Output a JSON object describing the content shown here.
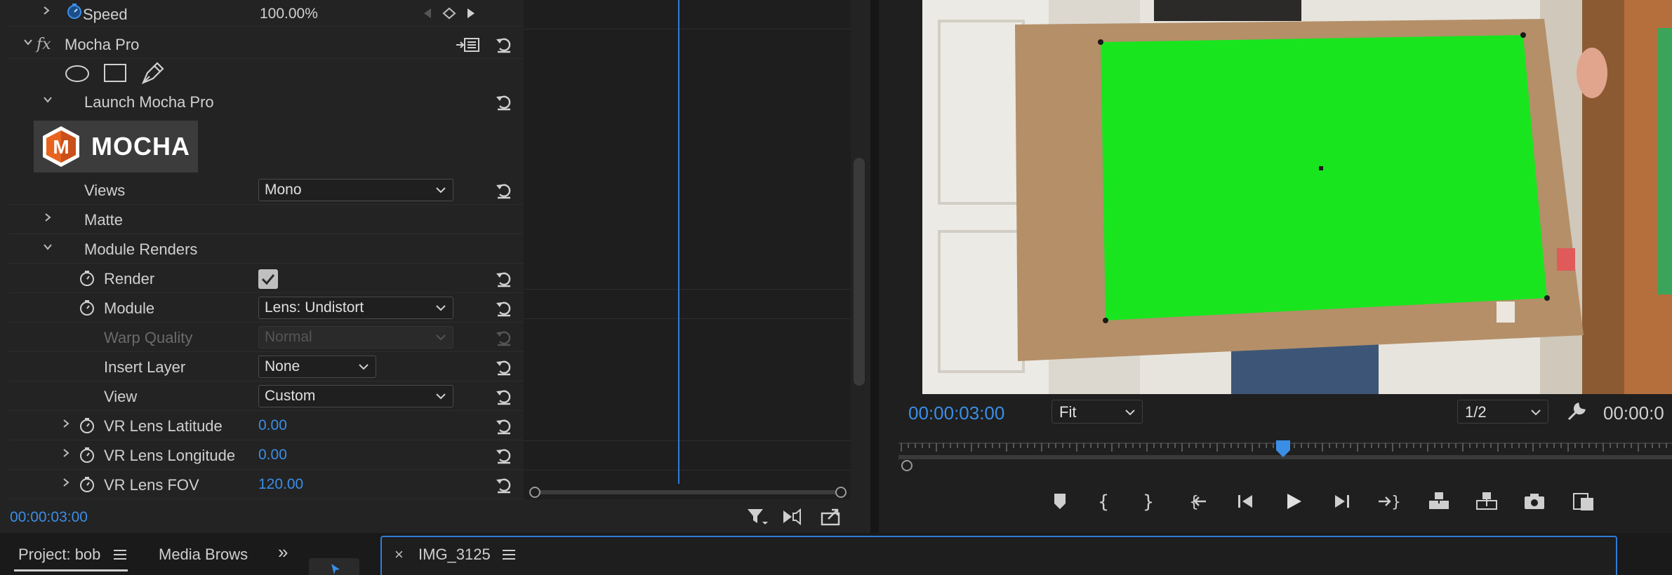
{
  "effect_controls": {
    "speed": {
      "label": "Speed",
      "value": "100.00%"
    },
    "mocha": {
      "fx_label": "fx",
      "name": "Mocha Pro",
      "launch_label": "Launch Mocha Pro",
      "logo_letter": "M",
      "logo_text": "MOCHA",
      "views": {
        "label": "Views",
        "value": "Mono"
      },
      "matte": {
        "label": "Matte"
      },
      "module_renders": {
        "label": "Module Renders"
      },
      "render": {
        "label": "Render",
        "checked": true
      },
      "module": {
        "label": "Module",
        "value": "Lens: Undistort"
      },
      "warp_quality": {
        "label": "Warp Quality",
        "value": "Normal"
      },
      "insert_layer": {
        "label": "Insert Layer",
        "value": "None"
      },
      "view": {
        "label": "View",
        "value": "Custom"
      },
      "vr_lat": {
        "label": "VR Lens Latitude",
        "value": "0.00"
      },
      "vr_lon": {
        "label": "VR Lens Longitude",
        "value": "0.00"
      },
      "vr_fov": {
        "label": "VR Lens FOV",
        "value": "120.00"
      }
    },
    "footer_timecode": "00:00:03:00"
  },
  "program_monitor": {
    "timecode": "00:00:03:00",
    "zoom": "Fit",
    "resolution": "1/2",
    "duration_timecode": "00:00:0"
  },
  "bottom_panels": {
    "project_tab": "Project: bob",
    "media_browser_tab": "Media Brows",
    "sequence_tab": "IMG_3125",
    "close_glyph": "×",
    "overflow_glyph": "»"
  },
  "colors": {
    "accent": "#2f7dd8",
    "timecode_blue": "#3a8ee6",
    "green_screen": "#19e51f"
  }
}
